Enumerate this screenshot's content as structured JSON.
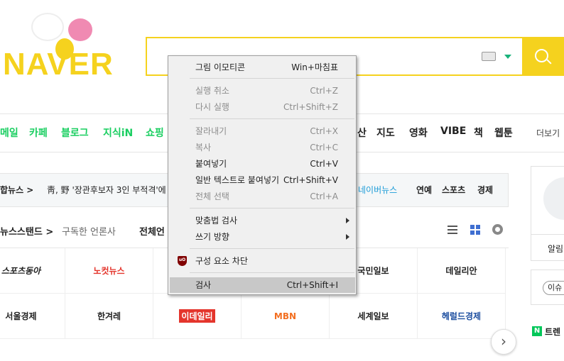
{
  "logo": {
    "text": "NAVER"
  },
  "nav": {
    "items": [
      "메일",
      "카페",
      "블로그",
      "지식iN",
      "쇼핑",
      "산",
      "지도",
      "영화",
      "VIBE",
      "책",
      "웹툰"
    ],
    "more": "더보기"
  },
  "news_bar": {
    "label": "합뉴스 >",
    "headline": "靑, 野 '장관후보자 3인 부적격'에",
    "links": [
      "네이버뉴스",
      "연예",
      "스포츠",
      "경제"
    ]
  },
  "newsstand": {
    "title": "뉴스스탠드 >",
    "subscribed": "구독한 언론사",
    "all": "전체언"
  },
  "press": {
    "row1": [
      "스포츠동아",
      "노컷뉴스",
      "",
      "",
      "국민일보",
      "데일리안"
    ],
    "row2": [
      "서울경제",
      "한겨레",
      "이데일리",
      "MBN",
      "세계일보",
      "헤럴드경제"
    ]
  },
  "right": {
    "alarm": "알림",
    "issue": "이슈",
    "trend": "트렌"
  },
  "context_menu": {
    "items": [
      {
        "label": "그림 이모티콘",
        "shortcut": "Win+마침표"
      },
      {
        "label": "실행 취소",
        "shortcut": "Ctrl+Z"
      },
      {
        "label": "다시 실행",
        "shortcut": "Ctrl+Shift+Z"
      },
      {
        "label": "잘라내기",
        "shortcut": "Ctrl+X"
      },
      {
        "label": "복사",
        "shortcut": "Ctrl+C"
      },
      {
        "label": "붙여넣기",
        "shortcut": "Ctrl+V"
      },
      {
        "label": "일반 텍스트로 붙여넣기",
        "shortcut": "Ctrl+Shift+V"
      },
      {
        "label": "전체 선택",
        "shortcut": "Ctrl+A"
      },
      {
        "label": "맞춤법 검사",
        "shortcut": ""
      },
      {
        "label": "쓰기 방향",
        "shortcut": ""
      },
      {
        "label": "구성 요소 차단",
        "shortcut": ""
      },
      {
        "label": "검사",
        "shortcut": "Ctrl+Shift+I"
      }
    ]
  },
  "colors": {
    "brand": "#f5d21e",
    "naver_green": "#19ce60",
    "ublock": "#800000"
  },
  "icons": [
    "keyboard-icon",
    "search-icon",
    "list-view-icon",
    "grid-view-icon",
    "settings-gear-icon",
    "chevron-right-icon",
    "ublock-icon"
  ]
}
